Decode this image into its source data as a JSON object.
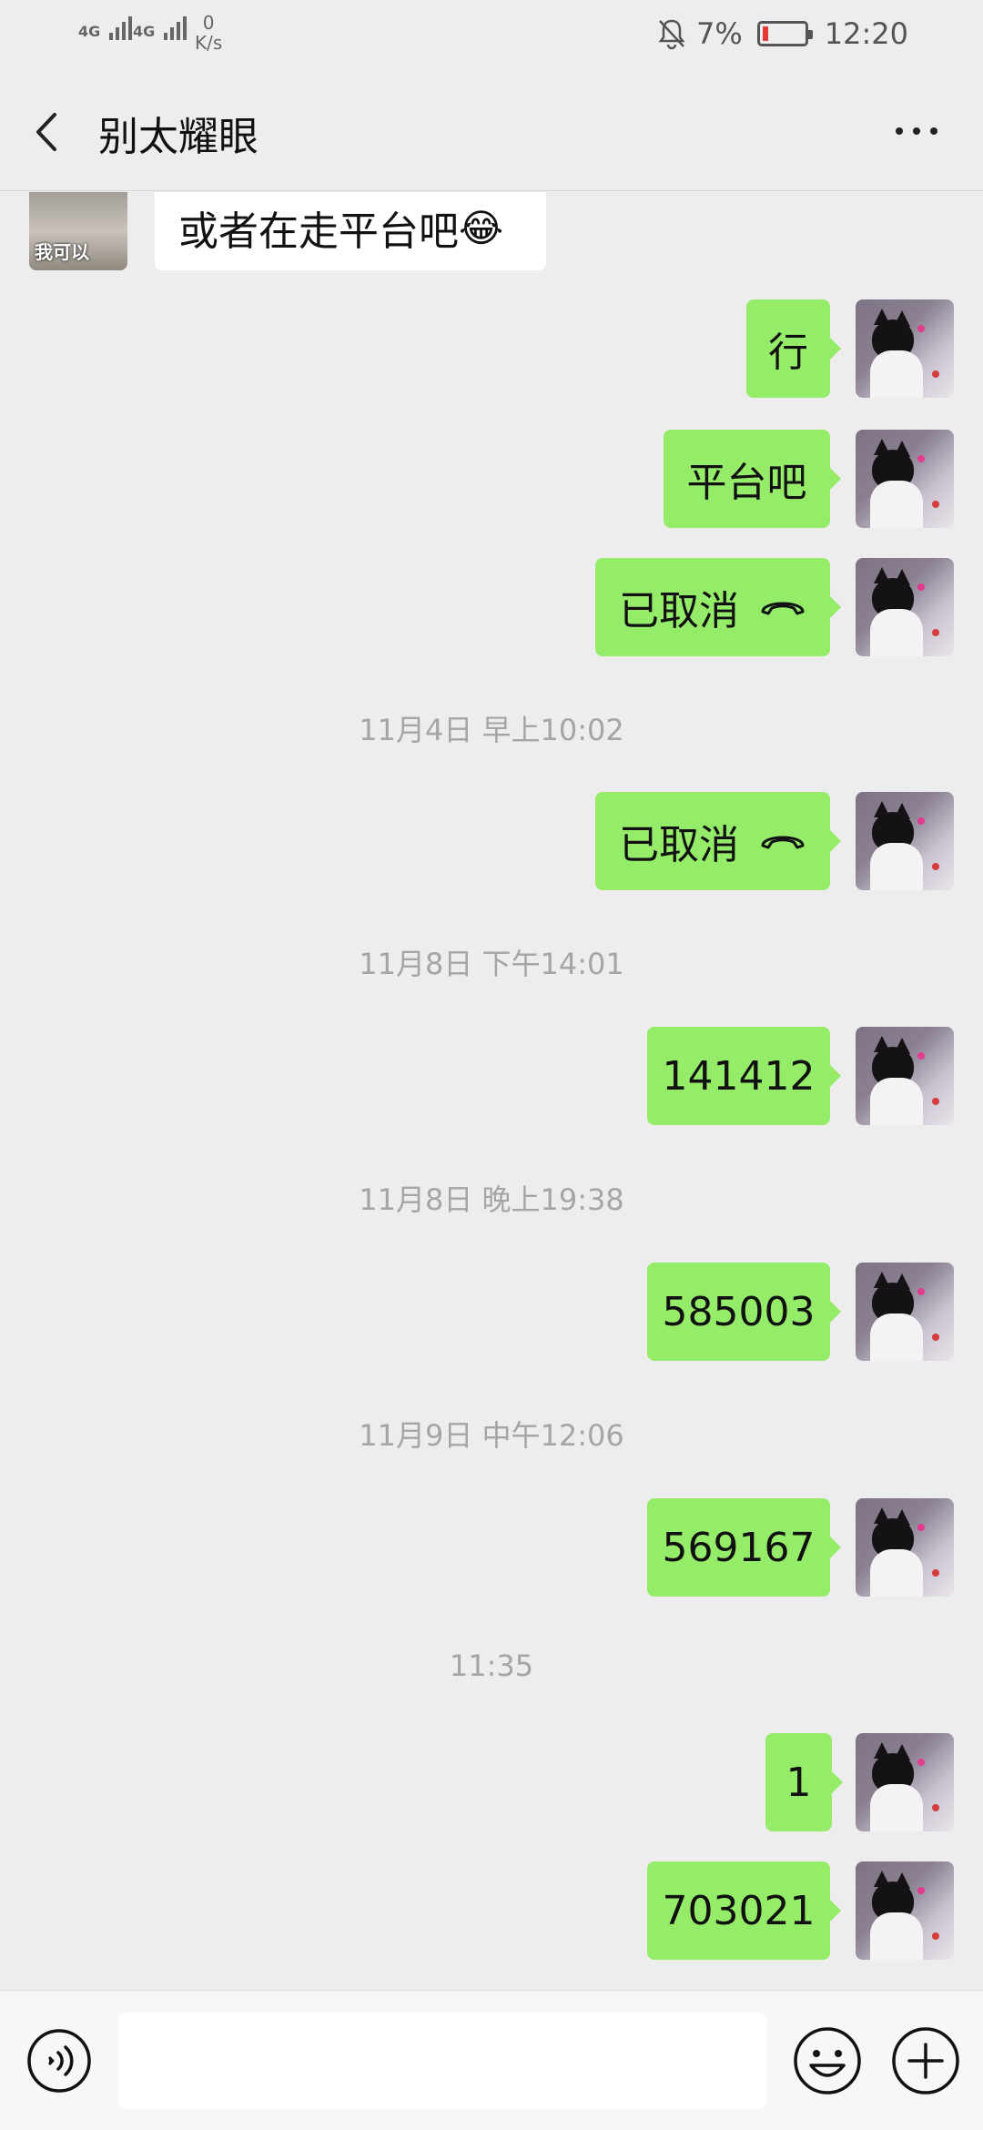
{
  "status_bar": {
    "signal1_label": "4G",
    "signal2_label": "4G",
    "speed_value": "0",
    "speed_unit": "K/s",
    "battery_percent": "7%",
    "time": "12:20"
  },
  "nav": {
    "title": "别太耀眼"
  },
  "messages": {
    "m0": {
      "text": "或者在走平台吧",
      "emoji": "😂",
      "sticker_text": "我可以"
    },
    "m1": {
      "text": "行"
    },
    "m2": {
      "text": "平台吧"
    },
    "m3": {
      "text": "已取消"
    },
    "t1": "11月4日 早上10:02",
    "m4": {
      "text": "已取消"
    },
    "t2": "11月8日 下午14:01",
    "m5": {
      "text": "141412"
    },
    "t3": "11月8日 晚上19:38",
    "m6": {
      "text": "585003"
    },
    "t4": "11月9日 中午12:06",
    "m7": {
      "text": "569167"
    },
    "t5": "11:35",
    "m8": {
      "text": "1"
    },
    "m9": {
      "text": "703021"
    }
  },
  "input": {
    "value": ""
  },
  "colors": {
    "my_bubble": "#95ec69",
    "other_bubble": "#ffffff",
    "background": "#ededed",
    "battery_low": "#e53935"
  },
  "icons": {
    "back": "chevron-left-icon",
    "more": "more-dots-icon",
    "call_cancelled": "hangup-phone-icon",
    "voice": "voice-icon",
    "emoji": "emoji-icon",
    "plus": "plus-icon",
    "mute": "bell-off-icon"
  }
}
